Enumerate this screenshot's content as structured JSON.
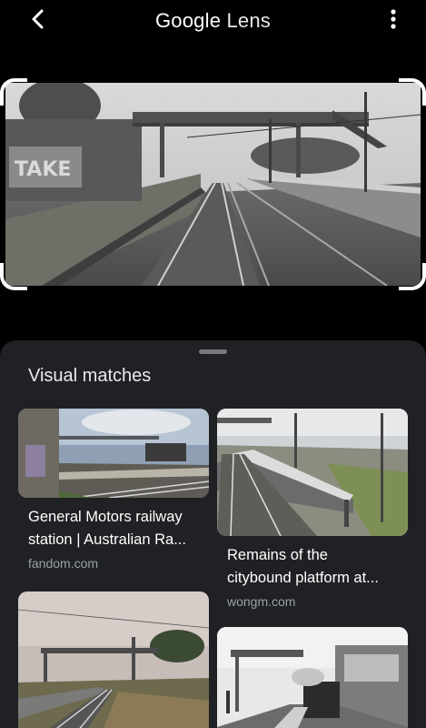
{
  "header": {
    "title_google": "Google",
    "title_lens": "Lens"
  },
  "icons": {
    "back": "chevron-left-icon",
    "more": "more-vert-icon"
  },
  "results": {
    "section_title": "Visual matches",
    "matches": [
      {
        "title": "General Motors railway\nstation | Australian Ra...",
        "source": "fandom.com"
      },
      {
        "title": "Remains of the\ncitybound platform at...",
        "source": "wongm.com"
      },
      {
        "title": "",
        "source": ""
      },
      {
        "title": "",
        "source": ""
      }
    ]
  },
  "colors": {
    "background": "#000000",
    "sheet": "#202124",
    "source_text": "#9aa0a6"
  }
}
